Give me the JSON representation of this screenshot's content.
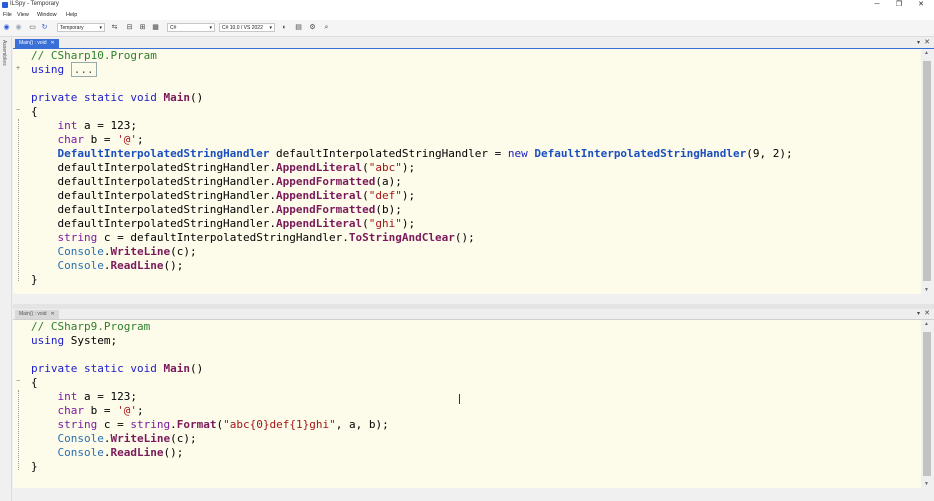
{
  "window": {
    "title": "ILSpy - Temporary",
    "minimize": "─",
    "maximize": "❐",
    "close": "✕"
  },
  "menu": [
    "File",
    "View",
    "Window",
    "Help"
  ],
  "toolbar": {
    "assembly_list": "Temporary",
    "language": "C#",
    "language_version": "C# 10.0 / VS 2022",
    "icons": [
      "back-icon",
      "forward-icon",
      "open-icon",
      "refresh-icon",
      "manage-lists-icon",
      "sort-icon",
      "collapse-icon",
      "show-all-icon",
      "dark-mode-icon",
      "theme-icon",
      "settings-icon",
      "search-icon"
    ]
  },
  "sidebar": {
    "label": "Assemblies"
  },
  "top_pane": {
    "tab": "Main() : void",
    "lines": [
      "// CSharp10.Program",
      "using ...",
      "",
      "private static void Main()",
      "{",
      "    int a = 123;",
      "    char b = '@';",
      "    DefaultInterpolatedStringHandler defaultInterpolatedStringHandler = new DefaultInterpolatedStringHandler(9, 2);",
      "    defaultInterpolatedStringHandler.AppendLiteral(\"abc\");",
      "    defaultInterpolatedStringHandler.AppendFormatted(a);",
      "    defaultInterpolatedStringHandler.AppendLiteral(\"def\");",
      "    defaultInterpolatedStringHandler.AppendFormatted(b);",
      "    defaultInterpolatedStringHandler.AppendLiteral(\"ghi\");",
      "    string c = defaultInterpolatedStringHandler.ToStringAndClear();",
      "    Console.WriteLine(c);",
      "    Console.ReadLine();",
      "}"
    ]
  },
  "bottom_pane": {
    "tab": "Main() : void",
    "lines": [
      "// CSharp9.Program",
      "using System;",
      "",
      "private static void Main()",
      "{",
      "    int a = 123;",
      "    char b = '@';",
      "    string c = string.Format(\"abc{0}def{1}ghi\", a, b);",
      "    Console.WriteLine(c);",
      "    Console.ReadLine();",
      "}"
    ]
  }
}
